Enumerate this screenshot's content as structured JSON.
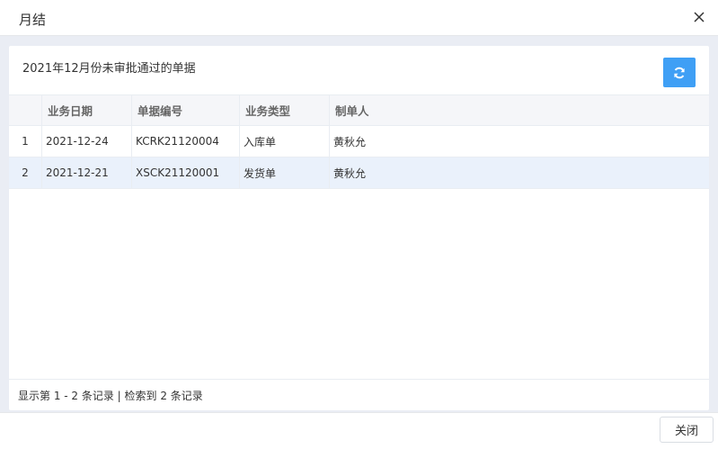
{
  "dialog": {
    "title": "月结",
    "close_icon": "close-icon",
    "close_button_label": "关闭"
  },
  "panel": {
    "caption": "2021年12月份未审批通过的单据",
    "refresh_icon": "refresh-icon"
  },
  "table": {
    "columns": [
      "",
      "业务日期",
      "单据编号",
      "业务类型",
      "制单人"
    ],
    "rows": [
      {
        "index": "1",
        "date": "2021-12-24",
        "doc_no": "KCRK21120004",
        "type": "入库单",
        "creator": "黄秋允"
      },
      {
        "index": "2",
        "date": "2021-12-21",
        "doc_no": "XSCK21120001",
        "type": "发货单",
        "creator": "黄秋允"
      }
    ],
    "footer": "显示第 1 - 2 条记录 | 检索到 2 条记录"
  },
  "colors": {
    "accent": "#3f9ff5",
    "body_bg": "#eaedf4",
    "selected_row": "#eaf1fb"
  }
}
